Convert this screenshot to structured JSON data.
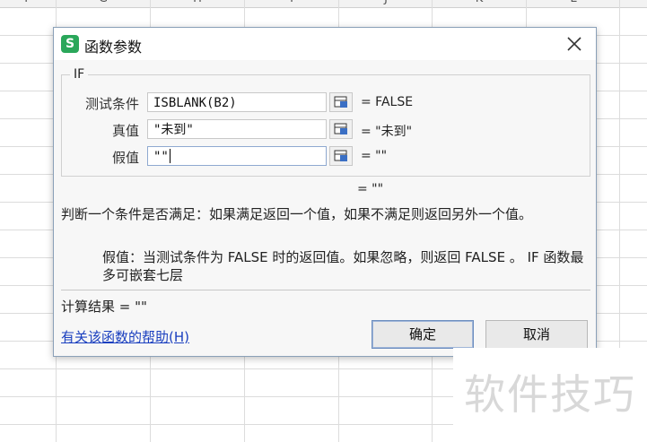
{
  "sheet": {
    "columns": [
      "F",
      "G",
      "H",
      "I",
      "J",
      "K",
      "L"
    ]
  },
  "dialog": {
    "icon_letter": "S",
    "title": "函数参数",
    "function_name": "IF",
    "args": [
      {
        "label": "测试条件",
        "value": "ISBLANK(B2)",
        "result": "= FALSE"
      },
      {
        "label": "真值",
        "value": "\"未到\"",
        "result": "= \"未到\""
      },
      {
        "label": "假值",
        "value": "\"\"",
        "result": "= \"\""
      }
    ],
    "formula_result": "= \"\"",
    "description": "判断一个条件是否满足：如果满足返回一个值，如果不满足则返回另外一个值。",
    "arg_description": "假值：当测试条件为 FALSE 时的返回值。如果忽略，则返回 FALSE 。 IF 函数最多可嵌套七层",
    "calc_result": "计算结果 = \"\"",
    "help_link": "有关该函数的帮助(H)",
    "ok_label": "确定",
    "cancel_label": "取消"
  },
  "watermark": "软件技巧"
}
